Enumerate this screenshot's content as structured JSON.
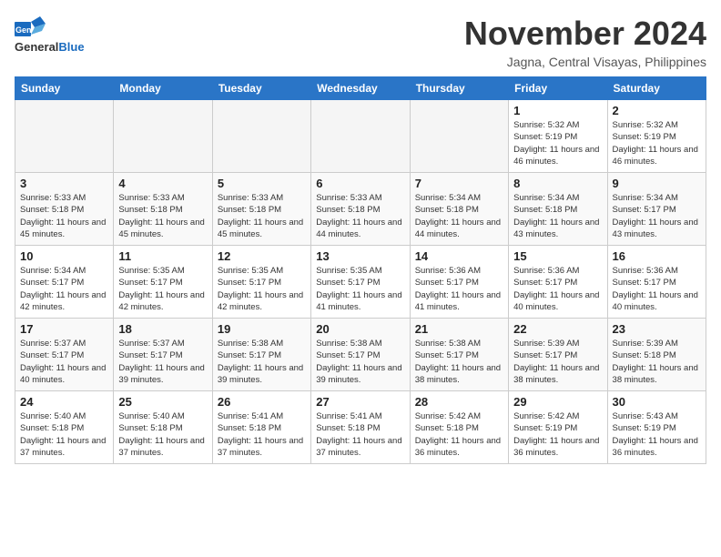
{
  "header": {
    "logo_line1": "General",
    "logo_line2": "Blue",
    "month": "November 2024",
    "location": "Jagna, Central Visayas, Philippines"
  },
  "weekdays": [
    "Sunday",
    "Monday",
    "Tuesday",
    "Wednesday",
    "Thursday",
    "Friday",
    "Saturday"
  ],
  "weeks": [
    [
      {
        "day": "",
        "empty": true
      },
      {
        "day": "",
        "empty": true
      },
      {
        "day": "",
        "empty": true
      },
      {
        "day": "",
        "empty": true
      },
      {
        "day": "",
        "empty": true
      },
      {
        "day": "1",
        "sunrise": "5:32 AM",
        "sunset": "5:19 PM",
        "daylight": "11 hours and 46 minutes."
      },
      {
        "day": "2",
        "sunrise": "5:32 AM",
        "sunset": "5:19 PM",
        "daylight": "11 hours and 46 minutes."
      }
    ],
    [
      {
        "day": "3",
        "sunrise": "5:33 AM",
        "sunset": "5:18 PM",
        "daylight": "11 hours and 45 minutes."
      },
      {
        "day": "4",
        "sunrise": "5:33 AM",
        "sunset": "5:18 PM",
        "daylight": "11 hours and 45 minutes."
      },
      {
        "day": "5",
        "sunrise": "5:33 AM",
        "sunset": "5:18 PM",
        "daylight": "11 hours and 45 minutes."
      },
      {
        "day": "6",
        "sunrise": "5:33 AM",
        "sunset": "5:18 PM",
        "daylight": "11 hours and 44 minutes."
      },
      {
        "day": "7",
        "sunrise": "5:34 AM",
        "sunset": "5:18 PM",
        "daylight": "11 hours and 44 minutes."
      },
      {
        "day": "8",
        "sunrise": "5:34 AM",
        "sunset": "5:18 PM",
        "daylight": "11 hours and 43 minutes."
      },
      {
        "day": "9",
        "sunrise": "5:34 AM",
        "sunset": "5:17 PM",
        "daylight": "11 hours and 43 minutes."
      }
    ],
    [
      {
        "day": "10",
        "sunrise": "5:34 AM",
        "sunset": "5:17 PM",
        "daylight": "11 hours and 42 minutes."
      },
      {
        "day": "11",
        "sunrise": "5:35 AM",
        "sunset": "5:17 PM",
        "daylight": "11 hours and 42 minutes."
      },
      {
        "day": "12",
        "sunrise": "5:35 AM",
        "sunset": "5:17 PM",
        "daylight": "11 hours and 42 minutes."
      },
      {
        "day": "13",
        "sunrise": "5:35 AM",
        "sunset": "5:17 PM",
        "daylight": "11 hours and 41 minutes."
      },
      {
        "day": "14",
        "sunrise": "5:36 AM",
        "sunset": "5:17 PM",
        "daylight": "11 hours and 41 minutes."
      },
      {
        "day": "15",
        "sunrise": "5:36 AM",
        "sunset": "5:17 PM",
        "daylight": "11 hours and 40 minutes."
      },
      {
        "day": "16",
        "sunrise": "5:36 AM",
        "sunset": "5:17 PM",
        "daylight": "11 hours and 40 minutes."
      }
    ],
    [
      {
        "day": "17",
        "sunrise": "5:37 AM",
        "sunset": "5:17 PM",
        "daylight": "11 hours and 40 minutes."
      },
      {
        "day": "18",
        "sunrise": "5:37 AM",
        "sunset": "5:17 PM",
        "daylight": "11 hours and 39 minutes."
      },
      {
        "day": "19",
        "sunrise": "5:38 AM",
        "sunset": "5:17 PM",
        "daylight": "11 hours and 39 minutes."
      },
      {
        "day": "20",
        "sunrise": "5:38 AM",
        "sunset": "5:17 PM",
        "daylight": "11 hours and 39 minutes."
      },
      {
        "day": "21",
        "sunrise": "5:38 AM",
        "sunset": "5:17 PM",
        "daylight": "11 hours and 38 minutes."
      },
      {
        "day": "22",
        "sunrise": "5:39 AM",
        "sunset": "5:17 PM",
        "daylight": "11 hours and 38 minutes."
      },
      {
        "day": "23",
        "sunrise": "5:39 AM",
        "sunset": "5:18 PM",
        "daylight": "11 hours and 38 minutes."
      }
    ],
    [
      {
        "day": "24",
        "sunrise": "5:40 AM",
        "sunset": "5:18 PM",
        "daylight": "11 hours and 37 minutes."
      },
      {
        "day": "25",
        "sunrise": "5:40 AM",
        "sunset": "5:18 PM",
        "daylight": "11 hours and 37 minutes."
      },
      {
        "day": "26",
        "sunrise": "5:41 AM",
        "sunset": "5:18 PM",
        "daylight": "11 hours and 37 minutes."
      },
      {
        "day": "27",
        "sunrise": "5:41 AM",
        "sunset": "5:18 PM",
        "daylight": "11 hours and 37 minutes."
      },
      {
        "day": "28",
        "sunrise": "5:42 AM",
        "sunset": "5:18 PM",
        "daylight": "11 hours and 36 minutes."
      },
      {
        "day": "29",
        "sunrise": "5:42 AM",
        "sunset": "5:19 PM",
        "daylight": "11 hours and 36 minutes."
      },
      {
        "day": "30",
        "sunrise": "5:43 AM",
        "sunset": "5:19 PM",
        "daylight": "11 hours and 36 minutes."
      }
    ]
  ]
}
